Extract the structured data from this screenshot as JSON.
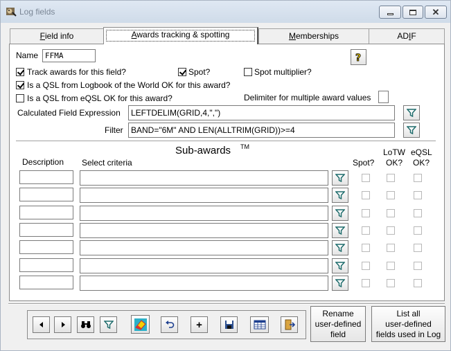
{
  "window": {
    "title": "Log fields"
  },
  "tabs": [
    {
      "prefix": "",
      "accel": "F",
      "rest": "ield info"
    },
    {
      "prefix": "",
      "accel": "A",
      "rest": "wards tracking & spotting"
    },
    {
      "prefix": "",
      "accel": "M",
      "rest": "emberships"
    },
    {
      "prefix": "AD",
      "accel": "I",
      "rest": "F"
    }
  ],
  "form": {
    "name_label": "Name",
    "name_value": "FFMA",
    "track_awards_label": "Track awards for this field?",
    "track_awards_checked": true,
    "spot_label": "Spot?",
    "spot_checked": true,
    "spot_multiplier_label": "Spot multiplier?",
    "spot_multiplier_checked": false,
    "lotw_label": "Is a  QSL from Logbook of the World OK for this award?",
    "lotw_checked": true,
    "eqsl_label": "Is a  QSL from eQSL OK for this award?",
    "eqsl_checked": false,
    "delimiter_label": "Delimiter for multiple award values",
    "delimiter_value": "",
    "calc_label": "Calculated Field Expression",
    "calc_value": "LEFTDELIM(GRID,4,\",\")",
    "filter_label": "Filter",
    "filter_value": "BAND=\"6M\" AND LEN(ALLTRIM(GRID))>=4"
  },
  "subawards": {
    "title": "Sub-awards",
    "tm": "TM",
    "col_description": "Description",
    "col_criteria": "Select criteria",
    "col_spot": "Spot?",
    "col_lotw_1": "LoTW",
    "col_lotw_2": "OK?",
    "col_eqsl_1": "eQSL",
    "col_eqsl_2": "OK?",
    "rows": [
      {
        "description": "",
        "criteria": ""
      },
      {
        "description": "",
        "criteria": ""
      },
      {
        "description": "",
        "criteria": ""
      },
      {
        "description": "",
        "criteria": ""
      },
      {
        "description": "",
        "criteria": ""
      },
      {
        "description": "",
        "criteria": ""
      },
      {
        "description": "",
        "criteria": ""
      }
    ]
  },
  "buttons": {
    "rename_1": "Rename",
    "rename_2": "user-defined",
    "rename_3": "field",
    "listall_1": "List all",
    "listall_2": "user-defined",
    "listall_3": "fields used in Log"
  },
  "toolbar": [
    "prev-record",
    "next-record",
    "find",
    "filter",
    "clear",
    "undo",
    "add",
    "save",
    "browse",
    "exit"
  ]
}
